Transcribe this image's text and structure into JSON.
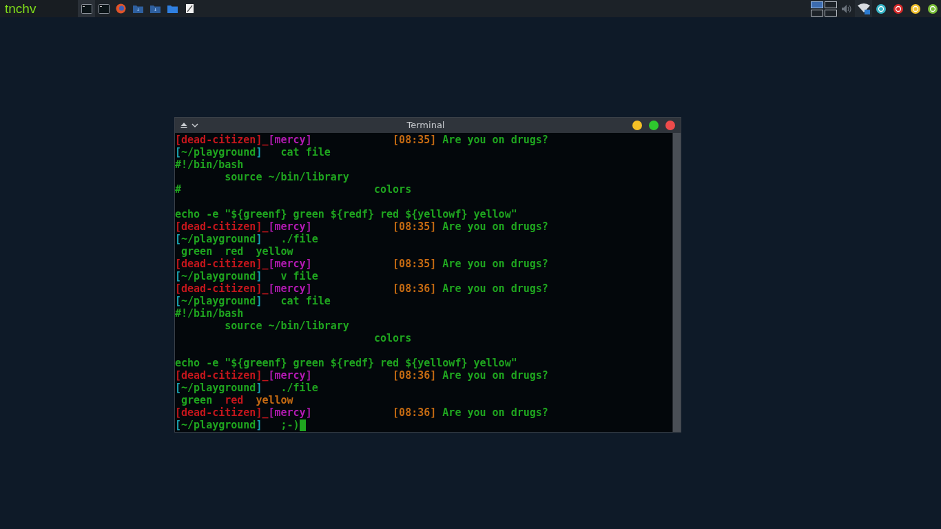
{
  "taskbar": {
    "logo": "tnchv",
    "workspaces": [
      {
        "selected": true
      },
      {
        "selected": false
      },
      {
        "selected": false
      },
      {
        "selected": false
      }
    ]
  },
  "terminal": {
    "title": "Terminal",
    "lines": [
      {
        "kind": "text",
        "segments": [
          {
            "text": "[dead-citizen]_",
            "color": "#c4161c"
          },
          {
            "text": "[mercy]",
            "color": "#b21ab2"
          },
          {
            "text": "             [08:35]",
            "color": "#c46a12"
          },
          {
            "text": " Are you on drugs?",
            "color": "#1fa51f"
          }
        ]
      },
      {
        "kind": "text",
        "segments": [
          {
            "text": "[",
            "color": "#19a6b5"
          },
          {
            "text": "~/playground",
            "color": "#1fa51f"
          },
          {
            "text": "]",
            "color": "#19a6b5"
          },
          {
            "text": "   cat file",
            "color": "#1fa51f"
          }
        ]
      },
      {
        "kind": "text",
        "segments": [
          {
            "text": "#!/bin/bash",
            "color": "#1fa51f"
          }
        ]
      },
      {
        "kind": "text",
        "segments": [
          {
            "text": "        source ~/bin/library",
            "color": "#1fa51f"
          }
        ]
      },
      {
        "kind": "text",
        "segments": [
          {
            "text": "#                               colors",
            "color": "#1fa51f"
          }
        ]
      },
      {
        "kind": "blank"
      },
      {
        "kind": "text",
        "segments": [
          {
            "text": "echo -e \"${greenf} green ${redf} red ${yellowf} yellow\"",
            "color": "#1fa51f"
          }
        ]
      },
      {
        "kind": "text",
        "segments": [
          {
            "text": "[dead-citizen]_",
            "color": "#c4161c"
          },
          {
            "text": "[mercy]",
            "color": "#b21ab2"
          },
          {
            "text": "             [08:35]",
            "color": "#c46a12"
          },
          {
            "text": " Are you on drugs?",
            "color": "#1fa51f"
          }
        ]
      },
      {
        "kind": "text",
        "segments": [
          {
            "text": "[",
            "color": "#19a6b5"
          },
          {
            "text": "~/playground",
            "color": "#1fa51f"
          },
          {
            "text": "]",
            "color": "#19a6b5"
          },
          {
            "text": "   ./file",
            "color": "#1fa51f"
          }
        ]
      },
      {
        "kind": "text",
        "segments": [
          {
            "text": " green  red  yellow",
            "color": "#1fa51f"
          }
        ]
      },
      {
        "kind": "text",
        "segments": [
          {
            "text": "[dead-citizen]_",
            "color": "#c4161c"
          },
          {
            "text": "[mercy]",
            "color": "#b21ab2"
          },
          {
            "text": "             [08:35]",
            "color": "#c46a12"
          },
          {
            "text": " Are you on drugs?",
            "color": "#1fa51f"
          }
        ]
      },
      {
        "kind": "text",
        "segments": [
          {
            "text": "[",
            "color": "#19a6b5"
          },
          {
            "text": "~/playground",
            "color": "#1fa51f"
          },
          {
            "text": "]",
            "color": "#19a6b5"
          },
          {
            "text": "   v file",
            "color": "#1fa51f"
          }
        ]
      },
      {
        "kind": "text",
        "segments": [
          {
            "text": "[dead-citizen]_",
            "color": "#c4161c"
          },
          {
            "text": "[mercy]",
            "color": "#b21ab2"
          },
          {
            "text": "             [08:36]",
            "color": "#c46a12"
          },
          {
            "text": " Are you on drugs?",
            "color": "#1fa51f"
          }
        ]
      },
      {
        "kind": "text",
        "segments": [
          {
            "text": "[",
            "color": "#19a6b5"
          },
          {
            "text": "~/playground",
            "color": "#1fa51f"
          },
          {
            "text": "]",
            "color": "#19a6b5"
          },
          {
            "text": "   cat file",
            "color": "#1fa51f"
          }
        ]
      },
      {
        "kind": "text",
        "segments": [
          {
            "text": "#!/bin/bash",
            "color": "#1fa51f"
          }
        ]
      },
      {
        "kind": "text",
        "segments": [
          {
            "text": "        source ~/bin/library",
            "color": "#1fa51f"
          }
        ]
      },
      {
        "kind": "text",
        "segments": [
          {
            "text": "                                colors",
            "color": "#1fa51f"
          }
        ]
      },
      {
        "kind": "blank"
      },
      {
        "kind": "text",
        "segments": [
          {
            "text": "echo -e \"${greenf} green ${redf} red ${yellowf} yellow\"",
            "color": "#1fa51f"
          }
        ]
      },
      {
        "kind": "text",
        "segments": [
          {
            "text": "[dead-citizen]_",
            "color": "#c4161c"
          },
          {
            "text": "[mercy]",
            "color": "#b21ab2"
          },
          {
            "text": "             [08:36]",
            "color": "#c46a12"
          },
          {
            "text": " Are you on drugs?",
            "color": "#1fa51f"
          }
        ]
      },
      {
        "kind": "text",
        "segments": [
          {
            "text": "[",
            "color": "#19a6b5"
          },
          {
            "text": "~/playground",
            "color": "#1fa51f"
          },
          {
            "text": "]",
            "color": "#19a6b5"
          },
          {
            "text": "   ./file",
            "color": "#1fa51f"
          }
        ]
      },
      {
        "kind": "text",
        "segments": [
          {
            "text": " green  ",
            "color": "#1fa51f"
          },
          {
            "text": "red  ",
            "color": "#c4161c"
          },
          {
            "text": "yellow",
            "color": "#c46a12"
          }
        ]
      },
      {
        "kind": "text",
        "segments": [
          {
            "text": "[dead-citizen]_",
            "color": "#c4161c"
          },
          {
            "text": "[mercy]",
            "color": "#b21ab2"
          },
          {
            "text": "             [08:36]",
            "color": "#c46a12"
          },
          {
            "text": " Are you on drugs?",
            "color": "#1fa51f"
          }
        ]
      },
      {
        "kind": "prompt",
        "segments": [
          {
            "text": "[",
            "color": "#19a6b5"
          },
          {
            "text": "~/playground",
            "color": "#1fa51f"
          },
          {
            "text": "]",
            "color": "#19a6b5"
          },
          {
            "text": "   ;-)",
            "color": "#1fa51f"
          }
        ]
      }
    ]
  }
}
